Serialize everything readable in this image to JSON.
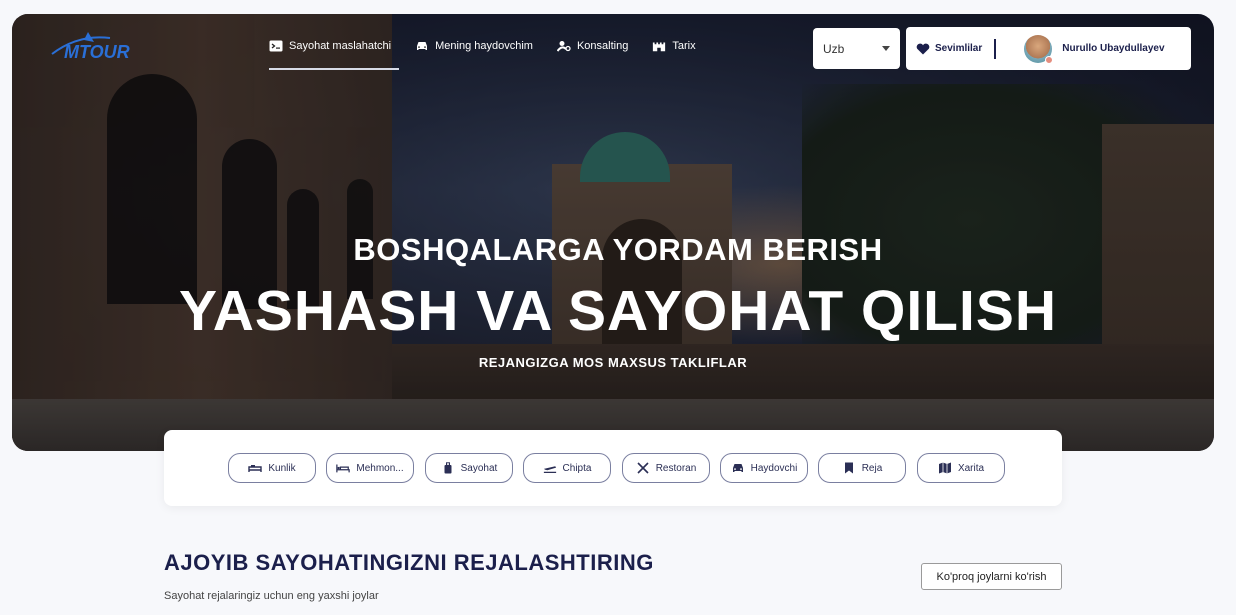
{
  "header": {
    "logo_text": "MTOUR",
    "nav": [
      {
        "label": "Sayohat maslahatchi",
        "icon": "terminal-icon",
        "active": true
      },
      {
        "label": "Mening haydovchim",
        "icon": "car-icon",
        "active": false
      },
      {
        "label": "Konsalting",
        "icon": "consult-icon",
        "active": false
      },
      {
        "label": "Tarix",
        "icon": "castle-icon",
        "active": false
      }
    ],
    "language": "Uzb",
    "favorites_label": "Sevimlilar",
    "user_name": "Nurullo Ubaydullayev"
  },
  "hero": {
    "subtitle": "BOSHQALARGA YORDAM BERISH",
    "title": "YASHASH VA SAYOHAT QILISH",
    "tagline": "REJANGIZGA MOS MAXSUS TAKLIFLAR"
  },
  "categories": [
    {
      "label": "Kunlik",
      "icon": "bed-car-icon"
    },
    {
      "label": "Mehmon...",
      "icon": "bed-icon"
    },
    {
      "label": "Sayohat",
      "icon": "luggage-icon"
    },
    {
      "label": "Chipta",
      "icon": "plane-icon"
    },
    {
      "label": "Restoran",
      "icon": "utensils-icon"
    },
    {
      "label": "Haydovchi",
      "icon": "car-icon"
    },
    {
      "label": "Reja",
      "icon": "bookmark-icon"
    },
    {
      "label": "Xarita",
      "icon": "map-icon"
    }
  ],
  "section": {
    "title": "AJOYIB SAYOHATINGIZNI REJALASHTIRING",
    "subtitle": "Sayohat rejalaringiz uchun eng yaxshi joylar",
    "more_label": "Ko'proq joylarni ko'rish"
  },
  "colors": {
    "brand_navy": "#1b1f4b",
    "card_border": "#7a7fa0",
    "logo_blue": "#2a6fd6"
  }
}
